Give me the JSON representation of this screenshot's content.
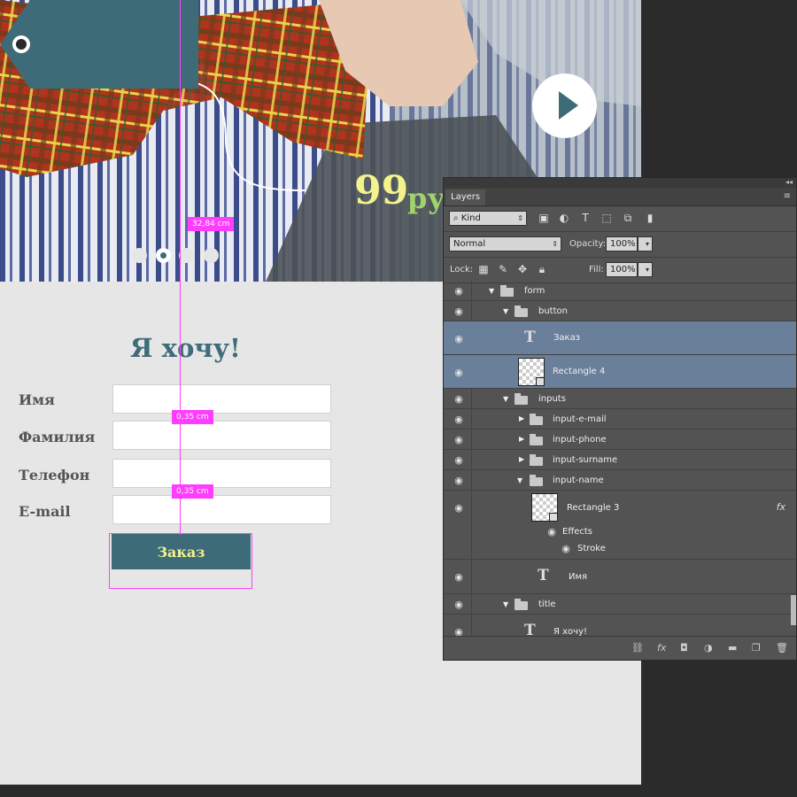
{
  "canvas": {
    "price_number": "99",
    "price_currency": "руб",
    "measure_top": "32,84 cm",
    "measure_mid1": "0,35 cm",
    "measure_mid2": "0,35 cm",
    "form_title": "Я хочу!",
    "fields": [
      {
        "label": "Имя"
      },
      {
        "label": "Фамилия"
      },
      {
        "label": "Телефон"
      },
      {
        "label": "E-mail"
      }
    ],
    "order_button": "Заказ",
    "slider_dots": 4,
    "slider_active_index": 1,
    "colors": {
      "accent": "#3d6b78",
      "price": "#f4f28c",
      "guide": "#ff3dff"
    }
  },
  "layers_panel": {
    "tab": "Layers",
    "filter_kind": "Kind",
    "blend_mode": "Normal",
    "opacity_label": "Opacity:",
    "opacity_value": "100%",
    "lock_label": "Lock:",
    "fill_label": "Fill:",
    "fill_value": "100%",
    "layers": [
      {
        "name": "form",
        "kind": "group",
        "expanded": true
      },
      {
        "name": "button",
        "kind": "group",
        "expanded": true
      },
      {
        "name": "Заказ",
        "kind": "text",
        "selected": true
      },
      {
        "name": "Rectangle 4",
        "kind": "shape",
        "selected": true
      },
      {
        "name": "inputs",
        "kind": "group",
        "expanded": true
      },
      {
        "name": "input-e-mail",
        "kind": "group",
        "expanded": false
      },
      {
        "name": "input-phone",
        "kind": "group",
        "expanded": false
      },
      {
        "name": "input-surname",
        "kind": "group",
        "expanded": false
      },
      {
        "name": "input-name",
        "kind": "group",
        "expanded": true
      },
      {
        "name": "Rectangle 3",
        "kind": "shape",
        "fx": "fx"
      },
      {
        "name": "Effects",
        "kind": "effects"
      },
      {
        "name": "Stroke",
        "kind": "effect"
      },
      {
        "name": "Имя",
        "kind": "text"
      },
      {
        "name": "title",
        "kind": "group",
        "expanded": true
      },
      {
        "name": "Я хочу!",
        "kind": "text"
      }
    ]
  }
}
